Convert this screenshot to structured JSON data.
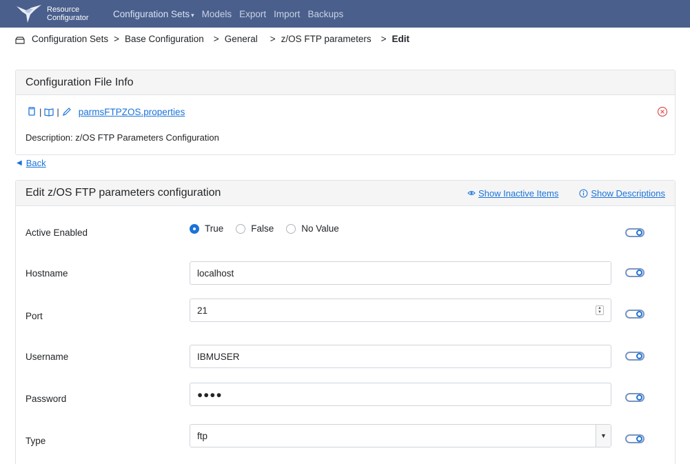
{
  "navbar": {
    "brand_line1": "Resource",
    "brand_line2": "Configurator",
    "items": [
      {
        "label": "Configuration Sets",
        "active": true,
        "caret": "▾"
      },
      {
        "label": "Models"
      },
      {
        "label": "Export"
      },
      {
        "label": "Import"
      },
      {
        "label": "Backups"
      }
    ]
  },
  "breadcrumb": {
    "icon": "folder-icon",
    "items": [
      "Configuration Sets",
      "Base Configuration",
      "General",
      "z/OS FTP parameters",
      "Edit"
    ],
    "separator": ">"
  },
  "file_info": {
    "title": "Configuration File Info",
    "file_name": "parmsFTPZOS.properties",
    "description": "Description:  z/OS FTP Parameters Configuration",
    "icons": [
      "copy-icon",
      "book-icon",
      "pencil-icon",
      "remove-circle-icon"
    ]
  },
  "back": {
    "label": "Back",
    "icon": "triangle-left-icon"
  },
  "edit_form": {
    "title": "Edit z/OS FTP parameters configuration",
    "show_inactive_label": "Show Inactive Items",
    "show_descriptions_label": "Show Descriptions",
    "active_enabled": {
      "label": "Active Enabled",
      "options": [
        "True",
        "False",
        "No Value"
      ],
      "selected": "True"
    },
    "hostname": {
      "label": "Hostname",
      "value": "localhost"
    },
    "port": {
      "label": "Port",
      "value": "21"
    },
    "username": {
      "label": "Username",
      "value": "IBMUSER"
    },
    "password": {
      "label": "Password",
      "value": "●●●●"
    },
    "type": {
      "label": "Type",
      "value": "ftp"
    }
  },
  "colors": {
    "navbar_bg": "#4a5f8c",
    "link": "#1a73d9",
    "remove": "#d9534f"
  }
}
